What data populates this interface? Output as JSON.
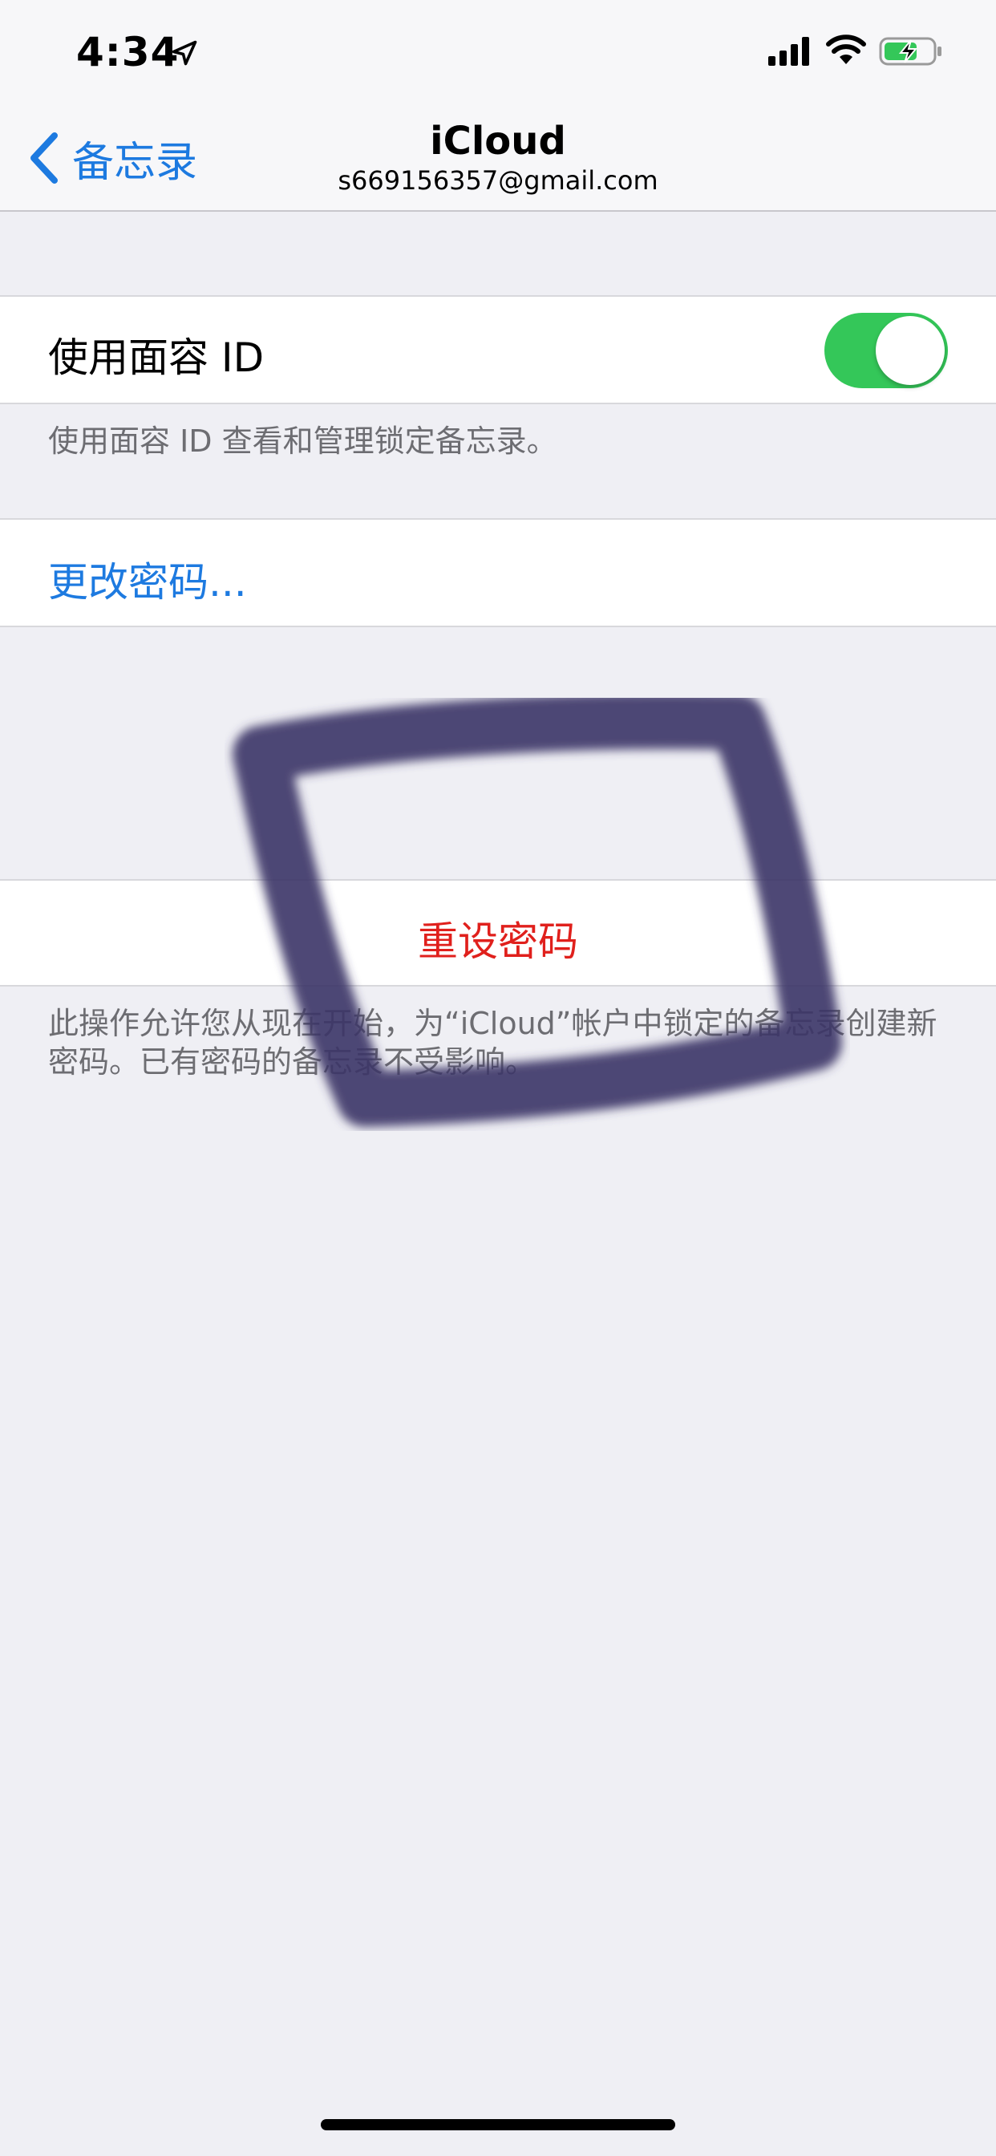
{
  "status_bar": {
    "time": "4:34",
    "icons": [
      "location-arrow-icon",
      "cellular-signal-icon",
      "wifi-icon",
      "battery-charging-icon"
    ],
    "battery_color": "#34c759"
  },
  "nav": {
    "back_label": "备忘录",
    "title": "iCloud",
    "subtitle": "s669156357@gmail.com"
  },
  "face_id": {
    "label": "使用面容 ID",
    "enabled": true,
    "footnote": "使用面容 ID 查看和管理锁定备忘录。"
  },
  "change_password": {
    "label": "更改密码..."
  },
  "reset_password": {
    "label": "重设密码",
    "footnote": "此操作允许您从现在开始，为“iCloud”帐户中锁定的备忘录创建新密码。已有密码的备忘录不受影响。"
  },
  "colors": {
    "accent": "#1d7ae0",
    "destructive": "#e0201c",
    "toggle_on": "#34c759",
    "background": "#efeff4",
    "scribble": "#3b3566"
  }
}
